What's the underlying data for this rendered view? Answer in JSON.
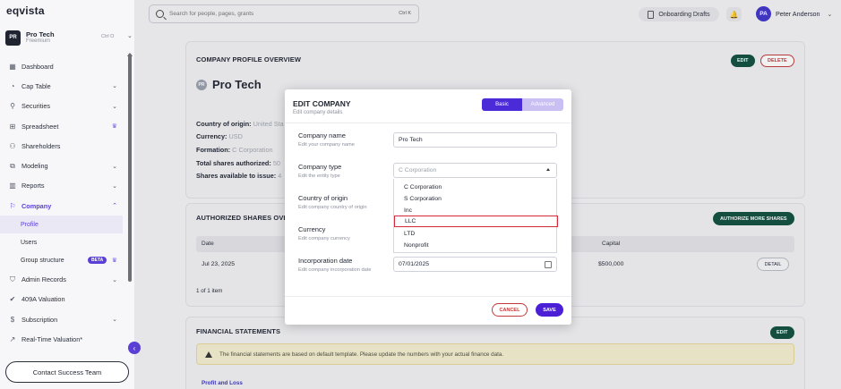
{
  "app": {
    "logo": "eqvista"
  },
  "company_switcher": {
    "avatar": "PR",
    "name": "Pro Tech",
    "plan": "Freemium",
    "shortcut": "Ctrl O"
  },
  "sidebar": {
    "items": [
      {
        "label": "Dashboard",
        "icon": "dashboard-icon"
      },
      {
        "label": "Cap Table",
        "icon": "pie-icon"
      },
      {
        "label": "Securities",
        "icon": "securities-icon"
      },
      {
        "label": "Spreadsheet",
        "icon": "spreadsheet-icon"
      },
      {
        "label": "Shareholders",
        "icon": "users-icon"
      },
      {
        "label": "Modeling",
        "icon": "modeling-icon"
      },
      {
        "label": "Reports",
        "icon": "reports-icon"
      },
      {
        "label": "Company",
        "icon": "company-icon"
      },
      {
        "label": "Admin Records",
        "icon": "shield-icon"
      },
      {
        "label": "409A Valuation",
        "icon": "check-badge-icon"
      },
      {
        "label": "Subscription",
        "icon": "dollar-icon"
      },
      {
        "label": "Real-Time Valuation*",
        "icon": "chart-icon"
      }
    ],
    "company_sub": [
      "Profile",
      "Users",
      "Group structure"
    ],
    "beta_label": "BETA",
    "contact_label": "Contact Success Team"
  },
  "topbar": {
    "search_placeholder": "Search for people, pages, grants",
    "search_shortcut": "Ctrl K",
    "drafts_label": "Onboarding Drafts",
    "user_initials": "PA",
    "user_name": "Peter Anderson"
  },
  "profile_card": {
    "title": "COMPANY PROFILE OVERVIEW",
    "edit_label": "EDIT",
    "delete_label": "DELETE",
    "avatar": "PR",
    "company_name": "Pro Tech",
    "rows": [
      {
        "label": "Country of origin:",
        "value": "United Sta"
      },
      {
        "label": "Currency:",
        "value": "USD"
      },
      {
        "label": "Formation:",
        "value": "C Corporation"
      },
      {
        "label": "Total shares authorized:",
        "value": "50"
      },
      {
        "label": "Shares available to issue:",
        "value": "4"
      }
    ]
  },
  "shares_card": {
    "title": "AUTHORIZED SHARES OVE",
    "action_label": "AUTHORIZE MORE SHARES",
    "headers": {
      "date": "Date",
      "capital": "Capital"
    },
    "row": {
      "date": "Jul 23, 2025",
      "capital": "$500,000",
      "action": "DETAIL"
    },
    "pager": "1 of 1 item"
  },
  "financial_card": {
    "title": "FINANCIAL STATEMENTS",
    "edit_label": "EDIT",
    "notice": "The financial statements are based on default template. Please update the numbers with your actual finance data.",
    "tab": "Profit and Loss"
  },
  "modal": {
    "title": "EDIT COMPANY",
    "subtitle": "Edit company details",
    "mode_basic": "Basic",
    "mode_advanced": "Advanced",
    "fields": {
      "name": {
        "label": "Company name",
        "help": "Edit your company name",
        "value": "Pro Tech"
      },
      "type": {
        "label": "Company type",
        "help": "Edit the entity type",
        "value": "C Corporation"
      },
      "country": {
        "label": "Country of origin",
        "help": "Edit company country of origin"
      },
      "currency": {
        "label": "Currency",
        "help": "Edit company currency"
      },
      "incorporation": {
        "label": "Incorporation date",
        "help": "Edit company incorporation date",
        "value": "07/01/2025"
      }
    },
    "type_options": [
      "C Corporation",
      "S Corporation",
      "Inc",
      "LLC",
      "LTD",
      "Nonprofit"
    ],
    "highlighted_option": "LLC",
    "cancel_label": "CANCEL",
    "save_label": "SAVE"
  },
  "colors": {
    "accent": "#4b1fd6",
    "green": "#0f4f3c",
    "danger": "#c23a3a",
    "highlight": "#d22a3a"
  }
}
